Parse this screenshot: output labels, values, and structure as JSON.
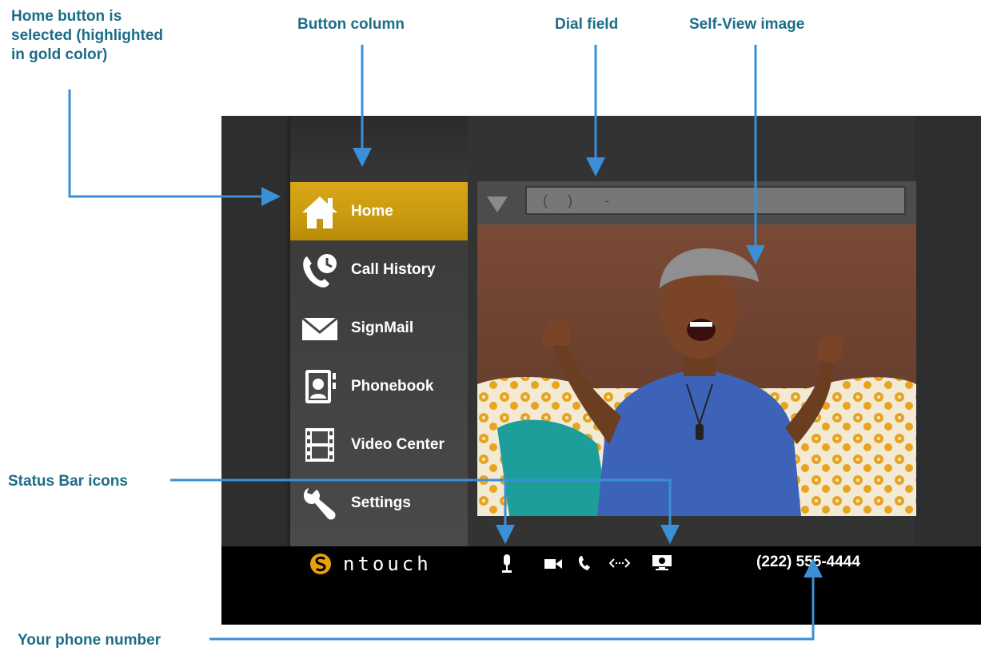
{
  "callouts": {
    "home_selected": [
      "Home button is",
      "selected (highlighted",
      "in gold color)"
    ],
    "button_column": "Button column",
    "dial_field": "Dial field",
    "self_view": "Self-View image",
    "status_bar_icons": "Status Bar icons",
    "your_phone_number": "Your phone number"
  },
  "menu": {
    "items": [
      {
        "label": "Home",
        "icon": "home-icon",
        "selected": true
      },
      {
        "label": "Call History",
        "icon": "call-history-icon",
        "selected": false
      },
      {
        "label": "SignMail",
        "icon": "envelope-icon",
        "selected": false
      },
      {
        "label": "Phonebook",
        "icon": "phonebook-icon",
        "selected": false
      },
      {
        "label": "Video Center",
        "icon": "film-icon",
        "selected": false
      },
      {
        "label": "Settings",
        "icon": "wrench-icon",
        "selected": false
      }
    ]
  },
  "dial": {
    "value": "(     )        -"
  },
  "status_bar": {
    "brand": "ntouch",
    "phone_number": "(222) 555-4444",
    "icons": [
      "microphone-icon",
      "video-camera-icon",
      "phone-icon",
      "network-icon",
      "monitor-icon"
    ]
  },
  "colors": {
    "callout_text": "#1c6d88",
    "arrow": "#3a8fd6",
    "selected_gold": "#c99a0f",
    "status_bar": "#000000"
  }
}
